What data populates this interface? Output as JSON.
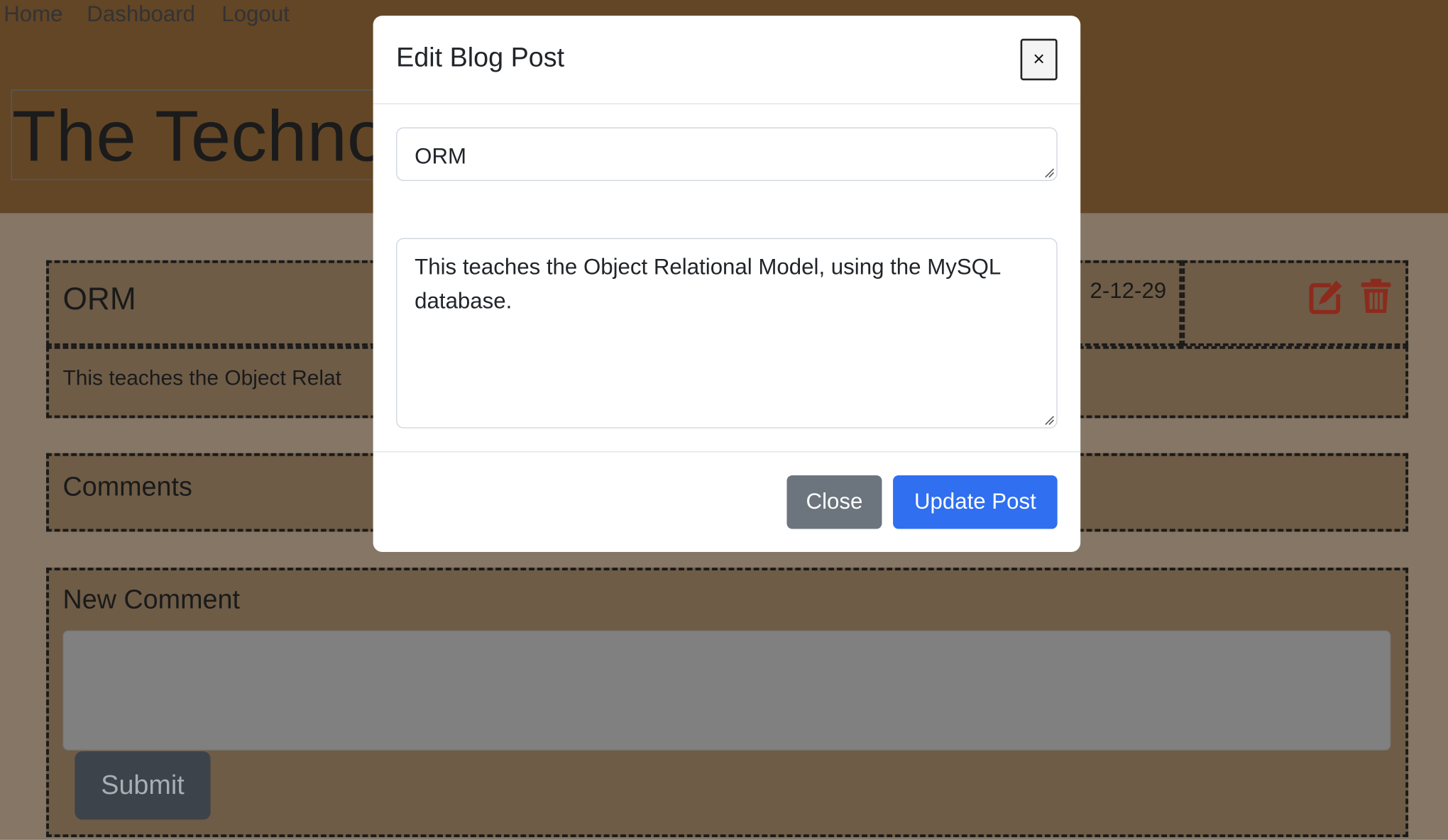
{
  "nav": {
    "home": "Home",
    "dashboard": "Dashboard",
    "logout": "Logout"
  },
  "site": {
    "title": "The Techno"
  },
  "post": {
    "title": "ORM",
    "date": "2-12-29",
    "body": "This teaches the Object Relat",
    "edit_icon": "edit-icon",
    "delete_icon": "trash-icon",
    "icon_color": "#8c2b1d"
  },
  "comments": {
    "heading": "Comments"
  },
  "new_comment": {
    "heading": "New Comment",
    "textarea_value": "",
    "submit_label": "Submit"
  },
  "modal": {
    "title": "Edit Blog Post",
    "close_icon_label": "×",
    "title_field_value": "ORM",
    "content_field_value": "This teaches the Object Relational Model, using the MySQL database.",
    "close_label": "Close",
    "update_label": "Update Post",
    "close_button_color": "#6c757d",
    "update_button_color": "#2f6ff0"
  }
}
